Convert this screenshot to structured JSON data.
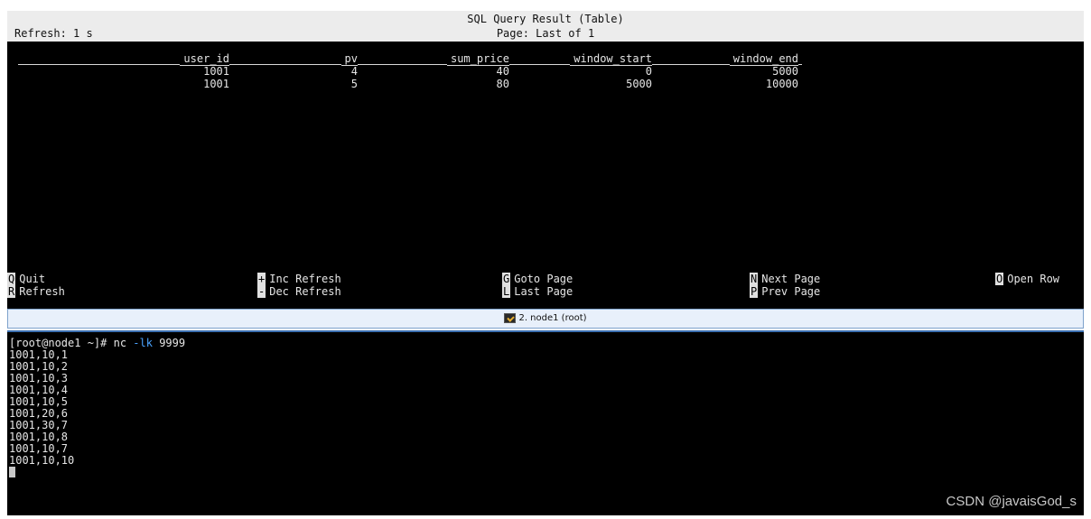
{
  "result_view": {
    "title": "SQL Query Result (Table)",
    "refresh": "Refresh: 1 s",
    "page": "Page: Last of 1",
    "columns": [
      "user_id",
      "pv",
      "sum_price",
      "window_start",
      "window_end"
    ],
    "rows": [
      [
        "1001",
        "4",
        "40",
        "0",
        "5000"
      ],
      [
        "1001",
        "5",
        "80",
        "5000",
        "10000"
      ]
    ],
    "menu": [
      {
        "key": "Q",
        "label": "Quit"
      },
      {
        "key": "+",
        "label": "Inc Refresh"
      },
      {
        "key": "G",
        "label": "Goto Page"
      },
      {
        "key": "N",
        "label": "Next Page"
      },
      {
        "key": "O",
        "label": "Open Row"
      },
      {
        "key": "R",
        "label": "Refresh"
      },
      {
        "key": "-",
        "label": "Dec Refresh"
      },
      {
        "key": "L",
        "label": "Last Page"
      },
      {
        "key": "P",
        "label": "Prev Page"
      }
    ]
  },
  "tab": {
    "label": "2. node1 (root)",
    "icon": "terminal-icon"
  },
  "terminal": {
    "prompt": "[root@node1 ~]# ",
    "cmd": "nc ",
    "flag": "-lk",
    "port": " 9999",
    "lines": [
      "1001,10,1",
      "1001,10,2",
      "1001,10,3",
      "1001,10,4",
      "1001,10,5",
      "1001,20,6",
      "1001,30,7",
      "1001,10,8",
      "1001,10,7",
      "1001,10,10"
    ]
  },
  "watermark": "CSDN @javaisGod_s",
  "colors": {
    "title_bar_bg": "#ececec",
    "terminal_bg": "#000000",
    "flag": "#4aa3ff",
    "tab_border": "#7ea2cc"
  }
}
